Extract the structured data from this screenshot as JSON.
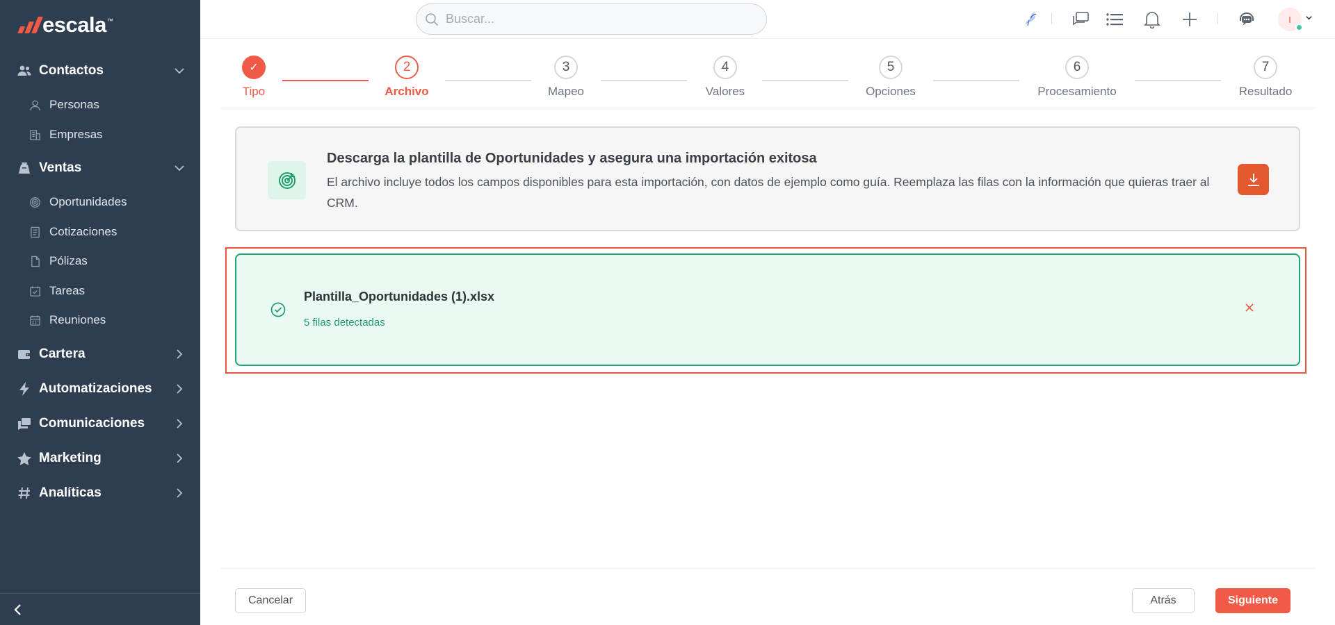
{
  "colors": {
    "sidebar_bg": "#2e3e50",
    "accent": "#f05a46",
    "success": "#1f9d6e",
    "download_button": "#e2582f"
  },
  "brand": {
    "name": "escala",
    "tm": "™"
  },
  "sidebar": {
    "sections": [
      {
        "label": "Contactos",
        "icon": "users-icon",
        "expanded": true,
        "items": [
          {
            "label": "Personas",
            "icon": "person-icon"
          },
          {
            "label": "Empresas",
            "icon": "building-icon"
          }
        ]
      },
      {
        "label": "Ventas",
        "icon": "sales-icon",
        "expanded": true,
        "items": [
          {
            "label": "Oportunidades",
            "icon": "target-icon"
          },
          {
            "label": "Cotizaciones",
            "icon": "document-icon"
          },
          {
            "label": "Pólizas",
            "icon": "file-icon"
          },
          {
            "label": "Tareas",
            "icon": "calendar-check-icon"
          },
          {
            "label": "Reuniones",
            "icon": "calendar-icon"
          }
        ]
      },
      {
        "label": "Cartera",
        "icon": "wallet-icon",
        "expanded": false,
        "items": []
      },
      {
        "label": "Automatizaciones",
        "icon": "bolt-icon",
        "expanded": false,
        "items": []
      },
      {
        "label": "Comunicaciones",
        "icon": "chat-icon",
        "expanded": false,
        "items": []
      },
      {
        "label": "Marketing",
        "icon": "star-icon",
        "expanded": false,
        "items": []
      },
      {
        "label": "Analíticas",
        "icon": "hash-icon",
        "expanded": false,
        "items": []
      }
    ]
  },
  "header": {
    "search_placeholder": "Buscar...",
    "avatar_initial": "I"
  },
  "stepper": {
    "steps": [
      {
        "number": "✓",
        "label": "Tipo",
        "state": "done"
      },
      {
        "number": "2",
        "label": "Archivo",
        "state": "active"
      },
      {
        "number": "3",
        "label": "Mapeo",
        "state": "pending"
      },
      {
        "number": "4",
        "label": "Valores",
        "state": "pending"
      },
      {
        "number": "5",
        "label": "Opciones",
        "state": "pending"
      },
      {
        "number": "6",
        "label": "Procesamiento",
        "state": "pending"
      },
      {
        "number": "7",
        "label": "Resultado",
        "state": "pending"
      }
    ]
  },
  "template_card": {
    "title": "Descarga la plantilla de Oportunidades y asegura una importación exitosa",
    "description": "El archivo incluye todos los campos disponibles para esta importación, con datos de ejemplo como guía. Reemplaza las filas con la información que quieras traer al CRM."
  },
  "file_card": {
    "filename": "Plantilla_Oportunidades (1).xlsx",
    "rows_detected": "5 filas detectadas"
  },
  "footer": {
    "cancel": "Cancelar",
    "back": "Atrás",
    "next": "Siguiente"
  }
}
